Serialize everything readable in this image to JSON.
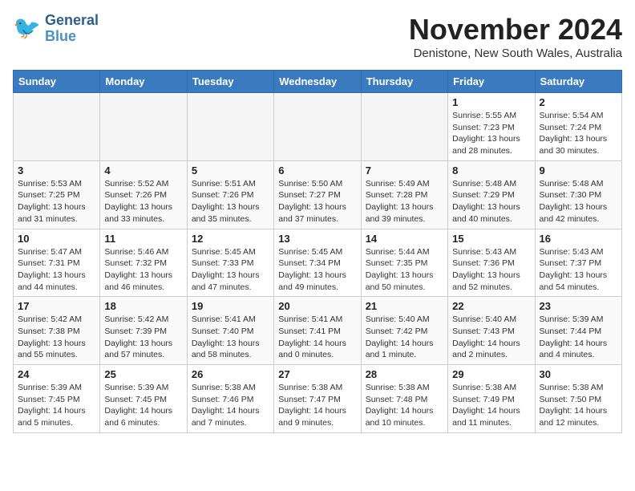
{
  "header": {
    "logo_line1": "General",
    "logo_line2": "Blue",
    "month": "November 2024",
    "location": "Denistone, New South Wales, Australia"
  },
  "weekdays": [
    "Sunday",
    "Monday",
    "Tuesday",
    "Wednesday",
    "Thursday",
    "Friday",
    "Saturday"
  ],
  "weeks": [
    [
      {
        "day": "",
        "info": ""
      },
      {
        "day": "",
        "info": ""
      },
      {
        "day": "",
        "info": ""
      },
      {
        "day": "",
        "info": ""
      },
      {
        "day": "",
        "info": ""
      },
      {
        "day": "1",
        "info": "Sunrise: 5:55 AM\nSunset: 7:23 PM\nDaylight: 13 hours\nand 28 minutes."
      },
      {
        "day": "2",
        "info": "Sunrise: 5:54 AM\nSunset: 7:24 PM\nDaylight: 13 hours\nand 30 minutes."
      }
    ],
    [
      {
        "day": "3",
        "info": "Sunrise: 5:53 AM\nSunset: 7:25 PM\nDaylight: 13 hours\nand 31 minutes."
      },
      {
        "day": "4",
        "info": "Sunrise: 5:52 AM\nSunset: 7:26 PM\nDaylight: 13 hours\nand 33 minutes."
      },
      {
        "day": "5",
        "info": "Sunrise: 5:51 AM\nSunset: 7:26 PM\nDaylight: 13 hours\nand 35 minutes."
      },
      {
        "day": "6",
        "info": "Sunrise: 5:50 AM\nSunset: 7:27 PM\nDaylight: 13 hours\nand 37 minutes."
      },
      {
        "day": "7",
        "info": "Sunrise: 5:49 AM\nSunset: 7:28 PM\nDaylight: 13 hours\nand 39 minutes."
      },
      {
        "day": "8",
        "info": "Sunrise: 5:48 AM\nSunset: 7:29 PM\nDaylight: 13 hours\nand 40 minutes."
      },
      {
        "day": "9",
        "info": "Sunrise: 5:48 AM\nSunset: 7:30 PM\nDaylight: 13 hours\nand 42 minutes."
      }
    ],
    [
      {
        "day": "10",
        "info": "Sunrise: 5:47 AM\nSunset: 7:31 PM\nDaylight: 13 hours\nand 44 minutes."
      },
      {
        "day": "11",
        "info": "Sunrise: 5:46 AM\nSunset: 7:32 PM\nDaylight: 13 hours\nand 46 minutes."
      },
      {
        "day": "12",
        "info": "Sunrise: 5:45 AM\nSunset: 7:33 PM\nDaylight: 13 hours\nand 47 minutes."
      },
      {
        "day": "13",
        "info": "Sunrise: 5:45 AM\nSunset: 7:34 PM\nDaylight: 13 hours\nand 49 minutes."
      },
      {
        "day": "14",
        "info": "Sunrise: 5:44 AM\nSunset: 7:35 PM\nDaylight: 13 hours\nand 50 minutes."
      },
      {
        "day": "15",
        "info": "Sunrise: 5:43 AM\nSunset: 7:36 PM\nDaylight: 13 hours\nand 52 minutes."
      },
      {
        "day": "16",
        "info": "Sunrise: 5:43 AM\nSunset: 7:37 PM\nDaylight: 13 hours\nand 54 minutes."
      }
    ],
    [
      {
        "day": "17",
        "info": "Sunrise: 5:42 AM\nSunset: 7:38 PM\nDaylight: 13 hours\nand 55 minutes."
      },
      {
        "day": "18",
        "info": "Sunrise: 5:42 AM\nSunset: 7:39 PM\nDaylight: 13 hours\nand 57 minutes."
      },
      {
        "day": "19",
        "info": "Sunrise: 5:41 AM\nSunset: 7:40 PM\nDaylight: 13 hours\nand 58 minutes."
      },
      {
        "day": "20",
        "info": "Sunrise: 5:41 AM\nSunset: 7:41 PM\nDaylight: 14 hours\nand 0 minutes."
      },
      {
        "day": "21",
        "info": "Sunrise: 5:40 AM\nSunset: 7:42 PM\nDaylight: 14 hours\nand 1 minute."
      },
      {
        "day": "22",
        "info": "Sunrise: 5:40 AM\nSunset: 7:43 PM\nDaylight: 14 hours\nand 2 minutes."
      },
      {
        "day": "23",
        "info": "Sunrise: 5:39 AM\nSunset: 7:44 PM\nDaylight: 14 hours\nand 4 minutes."
      }
    ],
    [
      {
        "day": "24",
        "info": "Sunrise: 5:39 AM\nSunset: 7:45 PM\nDaylight: 14 hours\nand 5 minutes."
      },
      {
        "day": "25",
        "info": "Sunrise: 5:39 AM\nSunset: 7:45 PM\nDaylight: 14 hours\nand 6 minutes."
      },
      {
        "day": "26",
        "info": "Sunrise: 5:38 AM\nSunset: 7:46 PM\nDaylight: 14 hours\nand 7 minutes."
      },
      {
        "day": "27",
        "info": "Sunrise: 5:38 AM\nSunset: 7:47 PM\nDaylight: 14 hours\nand 9 minutes."
      },
      {
        "day": "28",
        "info": "Sunrise: 5:38 AM\nSunset: 7:48 PM\nDaylight: 14 hours\nand 10 minutes."
      },
      {
        "day": "29",
        "info": "Sunrise: 5:38 AM\nSunset: 7:49 PM\nDaylight: 14 hours\nand 11 minutes."
      },
      {
        "day": "30",
        "info": "Sunrise: 5:38 AM\nSunset: 7:50 PM\nDaylight: 14 hours\nand 12 minutes."
      }
    ]
  ]
}
